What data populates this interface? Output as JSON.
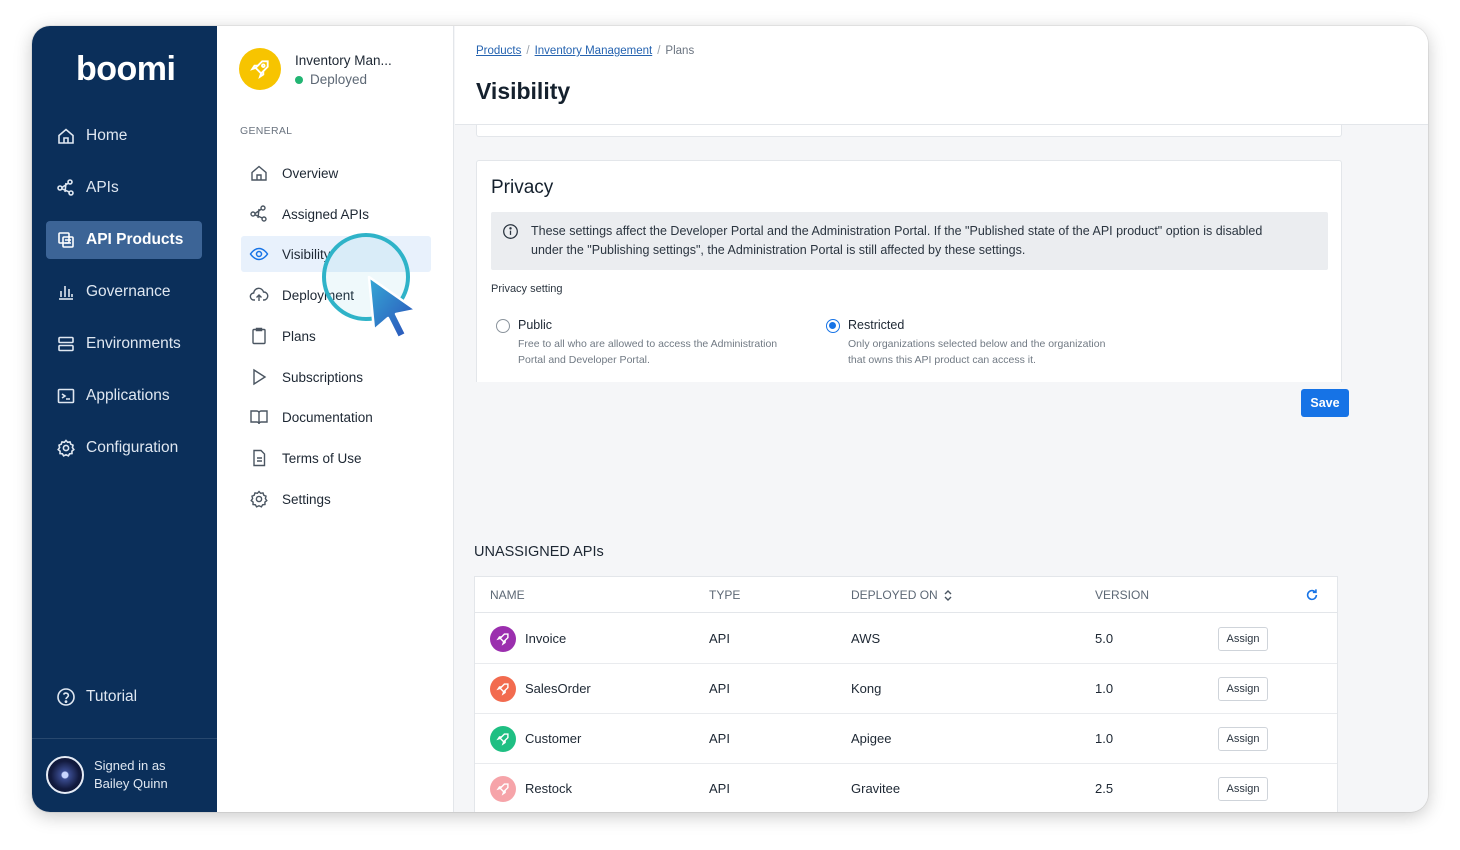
{
  "brand": "boomi",
  "nav": {
    "items": [
      {
        "label": "Home",
        "icon": "home-icon"
      },
      {
        "label": "APIs",
        "icon": "api-icon"
      },
      {
        "label": "API Products",
        "icon": "api-products-icon",
        "active": true
      },
      {
        "label": "Governance",
        "icon": "governance-icon"
      },
      {
        "label": "Environments",
        "icon": "environments-icon"
      },
      {
        "label": "Applications",
        "icon": "applications-icon"
      },
      {
        "label": "Configuration",
        "icon": "gear-icon"
      }
    ],
    "tutorial": "Tutorial",
    "signed_in_line1": "Signed in as",
    "signed_in_line2": "Bailey Quinn"
  },
  "product": {
    "name": "Inventory Man...",
    "status": "Deployed"
  },
  "subnav": {
    "section": "GENERAL",
    "items": [
      {
        "label": "Overview",
        "icon": "home-icon"
      },
      {
        "label": "Assigned APIs",
        "icon": "api-icon"
      },
      {
        "label": "Visibility",
        "icon": "eye-icon",
        "active": true
      },
      {
        "label": "Deployment",
        "icon": "cloud-upload-icon"
      },
      {
        "label": "Plans",
        "icon": "clipboard-icon"
      },
      {
        "label": "Subscriptions",
        "icon": "play-icon"
      },
      {
        "label": "Documentation",
        "icon": "book-icon"
      },
      {
        "label": "Terms of Use",
        "icon": "document-icon"
      },
      {
        "label": "Settings",
        "icon": "gear-icon"
      }
    ]
  },
  "breadcrumb": {
    "items": [
      "Products",
      "Inventory Management",
      "Plans"
    ],
    "separator": "/"
  },
  "page_title": "Visibility",
  "privacy": {
    "title": "Privacy",
    "info_line1": "These settings affect the Developer Portal and the Administration Portal. If the \"Published state of the API product\" option is disabled",
    "info_line2": "under the \"Publishing settings\", the Administration Portal is still affected by these settings.",
    "setting_label": "Privacy setting",
    "options": [
      {
        "label": "Public",
        "desc_line1": "Free to all who are allowed to access the Administration",
        "desc_line2": "Portal and Developer Portal.",
        "selected": false
      },
      {
        "label": "Restricted",
        "desc_line1": "Only organizations selected below and the organization",
        "desc_line2": "that owns this API product can access it.",
        "selected": true
      }
    ]
  },
  "save_label": "Save",
  "unassigned": {
    "title": "UNASSIGNED APIs",
    "columns": [
      "NAME",
      "TYPE",
      "DEPLOYED ON",
      "VERSION"
    ],
    "sort_icon": "sort-icon",
    "refresh_icon": "refresh-icon",
    "assign_label": "Assign",
    "rows": [
      {
        "name": "Invoice",
        "type": "API",
        "deployed_on": "AWS",
        "version": "5.0",
        "color": "#9b2fae"
      },
      {
        "name": "SalesOrder",
        "type": "API",
        "deployed_on": "Kong",
        "version": "1.0",
        "color": "#f26b4f"
      },
      {
        "name": "Customer",
        "type": "API",
        "deployed_on": "Apigee",
        "version": "1.0",
        "color": "#1fbf83"
      },
      {
        "name": "Restock",
        "type": "API",
        "deployed_on": "Gravitee",
        "version": "2.5",
        "color": "#f6a4a9"
      }
    ]
  },
  "colors": {
    "nav_bg": "#0b2f5a",
    "nav_active": "#3c6496",
    "accent": "#1673e6",
    "product_icon": "#f7c400",
    "deployed_dot": "#22b573"
  }
}
